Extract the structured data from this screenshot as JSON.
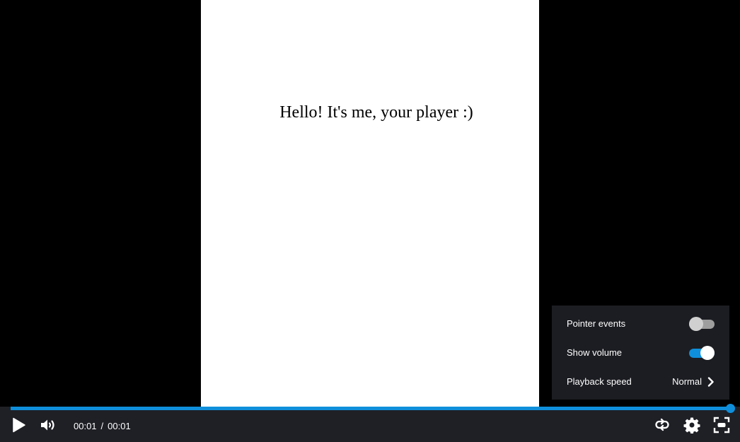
{
  "video": {
    "content_text": "Hello! It's me, your player :)"
  },
  "controls": {
    "play_icon": "play-icon",
    "volume_icon": "volume-icon",
    "current_time": "00:01",
    "separator": "/",
    "duration": "00:01",
    "loop_icon": "loop-icon",
    "settings_icon": "gear-icon",
    "fullscreen_icon": "fullscreen-icon",
    "progress_fraction": 1.0
  },
  "settings_menu": {
    "items": [
      {
        "label": "Pointer events",
        "type": "toggle",
        "enabled": false
      },
      {
        "label": "Show volume",
        "type": "toggle",
        "enabled": true
      },
      {
        "label": "Playback speed",
        "type": "submenu",
        "value": "Normal"
      }
    ]
  },
  "colors": {
    "accent": "#0f8fdb",
    "control_bar_bg": "#1f2026",
    "menu_bg": "#1c1d22"
  }
}
